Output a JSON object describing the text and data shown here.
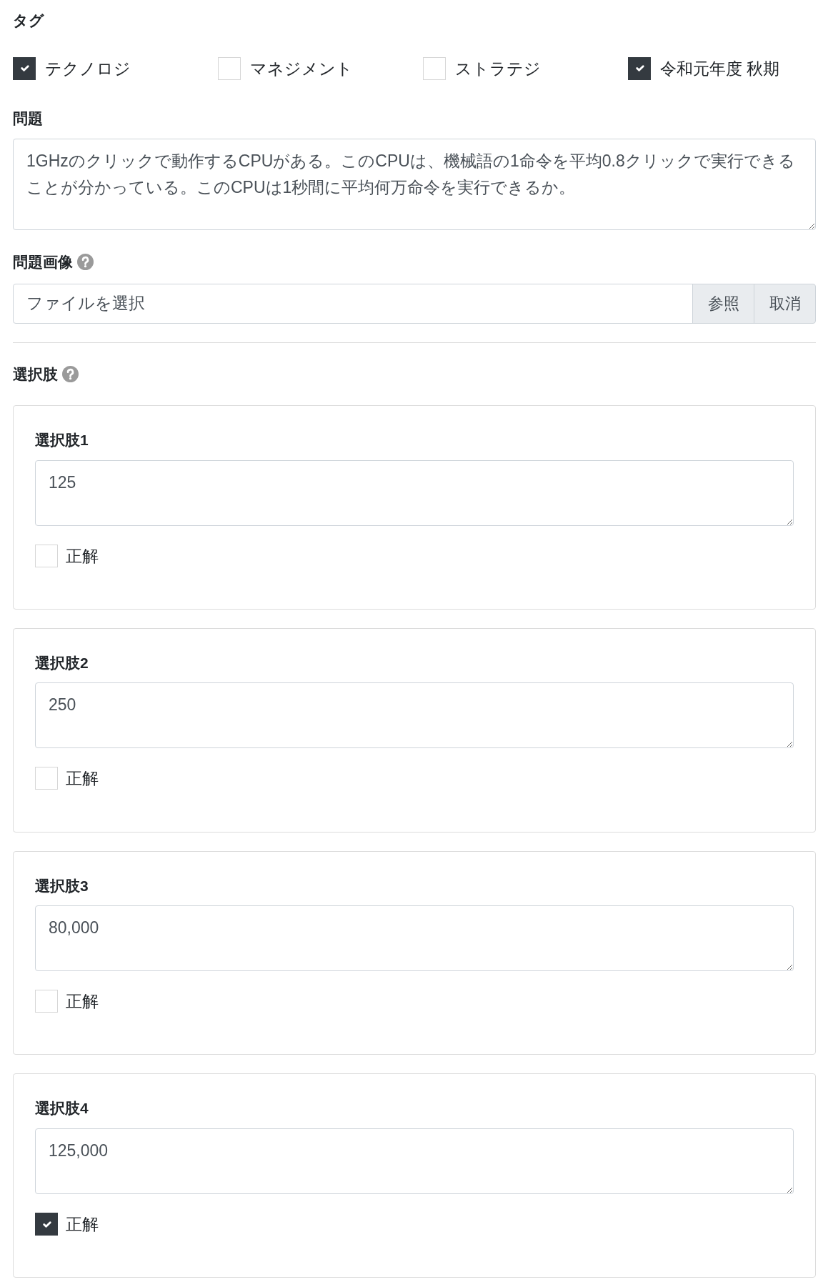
{
  "tags": {
    "label": "タグ",
    "items": [
      {
        "label": "テクノロジ",
        "checked": true
      },
      {
        "label": "マネジメント",
        "checked": false
      },
      {
        "label": "ストラテジ",
        "checked": false
      },
      {
        "label": "令和元年度 秋期",
        "checked": true
      }
    ]
  },
  "question": {
    "label": "問題",
    "value": "1GHzのクリックで動作するCPUがある。このCPUは、機械語の1命令を平均0.8クリックで実行できることが分かっている。このCPUは1秒間に平均何万命令を実行できるか。"
  },
  "question_image": {
    "label": "問題画像",
    "placeholder": "ファイルを選択",
    "buttons": [
      "参照",
      "取消"
    ]
  },
  "choices": {
    "label": "選択肢",
    "items": [
      {
        "label": "選択肢1",
        "value": "125",
        "correct": false,
        "correct_label": "正解"
      },
      {
        "label": "選択肢2",
        "value": "250",
        "correct": false,
        "correct_label": "正解"
      },
      {
        "label": "選択肢3",
        "value": "80,000",
        "correct": false,
        "correct_label": "正解"
      },
      {
        "label": "選択肢4",
        "value": "125,000",
        "correct": true,
        "correct_label": "正解"
      }
    ]
  }
}
